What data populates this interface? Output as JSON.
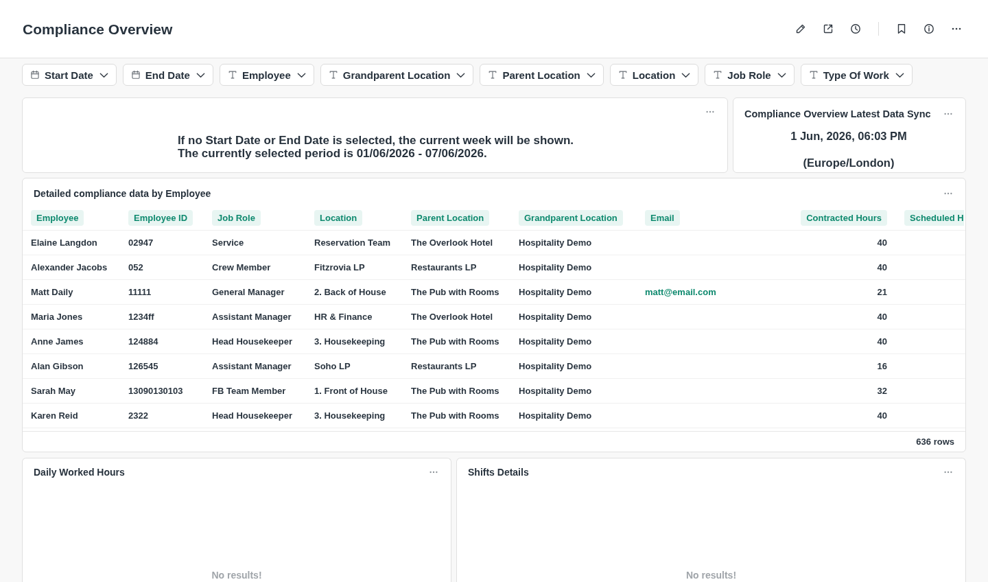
{
  "header": {
    "title": "Compliance Overview"
  },
  "filters": [
    {
      "label": "Start Date",
      "kind": "date"
    },
    {
      "label": "End Date",
      "kind": "date"
    },
    {
      "label": "Employee",
      "kind": "text"
    },
    {
      "label": "Grandparent Location",
      "kind": "text"
    },
    {
      "label": "Parent Location",
      "kind": "text"
    },
    {
      "label": "Location",
      "kind": "text"
    },
    {
      "label": "Job Role",
      "kind": "text"
    },
    {
      "label": "Type Of Work",
      "kind": "text"
    }
  ],
  "notice_card": {
    "lines": [
      "If no Start Date or End Date is selected, the current week will be shown.",
      "The currently selected period is 01/06/2026 - 07/06/2026."
    ]
  },
  "sync_card": {
    "title": "Compliance Overview Latest Data Sync",
    "datetime": "1 Jun, 2026, 06:03 PM",
    "timezone": "(Europe/London)"
  },
  "table_card": {
    "title": "Detailed compliance data by Employee",
    "columns": [
      {
        "label": "Employee"
      },
      {
        "label": "Employee ID"
      },
      {
        "label": "Job Role"
      },
      {
        "label": "Location"
      },
      {
        "label": "Parent Location"
      },
      {
        "label": "Grandparent Location"
      },
      {
        "label": "Email"
      },
      {
        "label": "Contracted Hours"
      },
      {
        "label": "Scheduled H"
      }
    ],
    "rows": [
      {
        "employee": "Elaine Langdon",
        "employee_id": "02947",
        "job_role": "Service",
        "location": "Reservation Team",
        "parent_location": "The Overlook Hotel",
        "grandparent_location": "Hospitality Demo",
        "contracted_hours": "40"
      },
      {
        "employee": "Alexander Jacobs",
        "employee_id": "052",
        "job_role": "Crew Member",
        "location": "Fitzrovia LP",
        "parent_location": "Restaurants LP",
        "grandparent_location": "Hospitality Demo",
        "contracted_hours": "40"
      },
      {
        "employee": "Matt Daily",
        "employee_id": "11111",
        "job_role": "General Manager",
        "location": "2. Back of House",
        "parent_location": "The Pub with Rooms",
        "grandparent_location": "Hospitality Demo",
        "email": "matt@email.com",
        "contracted_hours": "21"
      },
      {
        "employee": "Maria Jones",
        "employee_id": "1234ff",
        "job_role": "Assistant Manager",
        "location": "HR & Finance",
        "parent_location": "The Overlook Hotel",
        "grandparent_location": "Hospitality Demo",
        "contracted_hours": "40"
      },
      {
        "employee": "Anne James",
        "employee_id": "124884",
        "job_role": "Head Housekeeper",
        "location": "3. Housekeeping",
        "parent_location": "The Pub with Rooms",
        "grandparent_location": "Hospitality Demo",
        "contracted_hours": "40"
      },
      {
        "employee": "Alan Gibson",
        "employee_id": "126545",
        "job_role": "Assistant Manager",
        "location": "Soho LP",
        "parent_location": "Restaurants LP",
        "grandparent_location": "Hospitality Demo",
        "contracted_hours": "16"
      },
      {
        "employee": "Sarah May",
        "employee_id": "13090130103",
        "job_role": "FB Team Member",
        "location": "1. Front of House",
        "parent_location": "The Pub with Rooms",
        "grandparent_location": "Hospitality Demo",
        "contracted_hours": "32"
      },
      {
        "employee": "Karen Reid",
        "employee_id": "2322",
        "job_role": "Head Housekeeper",
        "location": "3. Housekeeping",
        "parent_location": "The Pub with Rooms",
        "grandparent_location": "Hospitality Demo",
        "contracted_hours": "40"
      }
    ],
    "row_count": "636 rows"
  },
  "panels": [
    {
      "title": "Daily Worked Hours",
      "empty_message": "No results!"
    },
    {
      "title": "Shifts Details",
      "empty_message": "No results!"
    }
  ]
}
